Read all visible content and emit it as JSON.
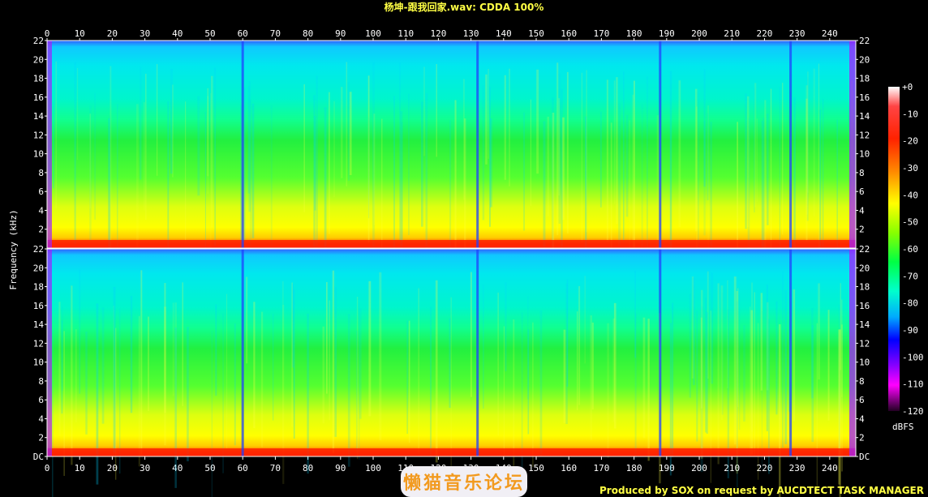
{
  "chart_data": {
    "type": "heatmap",
    "title": "杨坤-跟我回家.wav: CDDA 100%",
    "xlabel": "",
    "ylabel": "Frequency (kHz)",
    "x_ticks": [
      "0",
      "10",
      "20",
      "30",
      "40",
      "50",
      "60",
      "70",
      "80",
      "90",
      "100",
      "110",
      "120",
      "130",
      "140",
      "150",
      "160",
      "170",
      "180",
      "190",
      "200",
      "210",
      "220",
      "230",
      "240"
    ],
    "xlim": [
      0,
      248
    ],
    "channels": [
      {
        "name": "",
        "y_ticks": [
          "22",
          "20",
          "18",
          "16",
          "14",
          "12",
          "10",
          "8",
          "6",
          "4",
          "2"
        ],
        "ylim": [
          0,
          22
        ]
      },
      {
        "name": "",
        "y_ticks": [
          "22",
          "20",
          "18",
          "16",
          "14",
          "12",
          "10",
          "8",
          "6",
          "4",
          "2",
          "DC"
        ],
        "ylim": [
          0,
          22
        ]
      }
    ],
    "section_boundaries_s": [
      60,
      132,
      188,
      228
    ],
    "colorbar": {
      "label": "dBFS",
      "ticks": [
        "+0",
        "-10",
        "-20",
        "-30",
        "-40",
        "-50",
        "-60",
        "-70",
        "-80",
        "-90",
        "-100",
        "-110",
        "-120"
      ],
      "range": [
        -120,
        0
      ],
      "colors": [
        "#ffffff",
        "#ff3333",
        "#ff3300",
        "#ff8800",
        "#ffff00",
        "#99ff00",
        "#00ff33",
        "#00ffcc",
        "#00aaff",
        "#0000ff",
        "#8800ff",
        "#ff00ff",
        "#440044"
      ]
    },
    "footer": "Produced by SOX on request by AUCDTECT TASK MANAGER"
  },
  "watermark": "懒猫音乐论坛"
}
